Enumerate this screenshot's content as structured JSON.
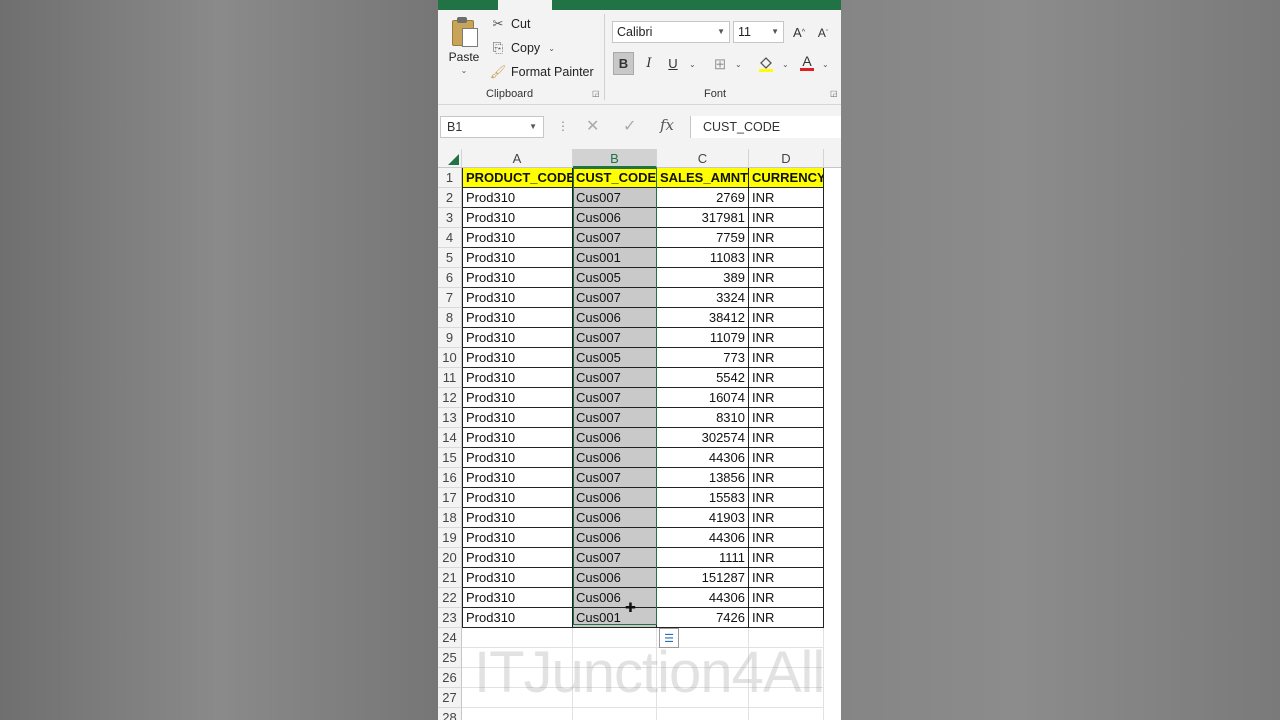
{
  "ribbon": {
    "clipboard": {
      "paste_label": "Paste",
      "cut_label": "Cut",
      "copy_label": "Copy",
      "format_painter_label": "Format Painter",
      "group_label": "Clipboard"
    },
    "font": {
      "font_name": "Calibri",
      "font_size": "11",
      "bold_label": "B",
      "italic_label": "I",
      "underline_label": "U",
      "font_color_label": "A",
      "group_label": "Font"
    }
  },
  "formula_bar": {
    "name_box": "B1",
    "fx_label": "fx",
    "content": "CUST_CODE"
  },
  "sheet": {
    "column_headers": [
      "A",
      "B",
      "C",
      "D"
    ],
    "header_row": [
      "PRODUCT_CODE",
      "CUST_CODE",
      "SALES_AMNT",
      "CURRENCY"
    ],
    "rows": [
      [
        "Prod310",
        "Cus007",
        "2769",
        "INR"
      ],
      [
        "Prod310",
        "Cus006",
        "317981",
        "INR"
      ],
      [
        "Prod310",
        "Cus007",
        "7759",
        "INR"
      ],
      [
        "Prod310",
        "Cus001",
        "11083",
        "INR"
      ],
      [
        "Prod310",
        "Cus005",
        "389",
        "INR"
      ],
      [
        "Prod310",
        "Cus007",
        "3324",
        "INR"
      ],
      [
        "Prod310",
        "Cus006",
        "38412",
        "INR"
      ],
      [
        "Prod310",
        "Cus007",
        "11079",
        "INR"
      ],
      [
        "Prod310",
        "Cus005",
        "773",
        "INR"
      ],
      [
        "Prod310",
        "Cus007",
        "5542",
        "INR"
      ],
      [
        "Prod310",
        "Cus007",
        "16074",
        "INR"
      ],
      [
        "Prod310",
        "Cus007",
        "8310",
        "INR"
      ],
      [
        "Prod310",
        "Cus006",
        "302574",
        "INR"
      ],
      [
        "Prod310",
        "Cus006",
        "44306",
        "INR"
      ],
      [
        "Prod310",
        "Cus007",
        "13856",
        "INR"
      ],
      [
        "Prod310",
        "Cus006",
        "15583",
        "INR"
      ],
      [
        "Prod310",
        "Cus006",
        "41903",
        "INR"
      ],
      [
        "Prod310",
        "Cus006",
        "44306",
        "INR"
      ],
      [
        "Prod310",
        "Cus007",
        "1111",
        "INR"
      ],
      [
        "Prod310",
        "Cus006",
        "151287",
        "INR"
      ],
      [
        "Prod310",
        "Cus006",
        "44306",
        "INR"
      ],
      [
        "Prod310",
        "Cus001",
        "7426",
        "INR"
      ]
    ],
    "row_numbers": [
      "1",
      "2",
      "3",
      "4",
      "5",
      "6",
      "7",
      "8",
      "9",
      "10",
      "11",
      "12",
      "13",
      "14",
      "15",
      "16",
      "17",
      "18",
      "19",
      "20",
      "21",
      "22",
      "23",
      "24",
      "25",
      "26",
      "27",
      "28"
    ],
    "selected_column": "B",
    "header_fill_color": "#ffff00",
    "selection_color": "#217346"
  },
  "watermark": "ITJunction4All"
}
